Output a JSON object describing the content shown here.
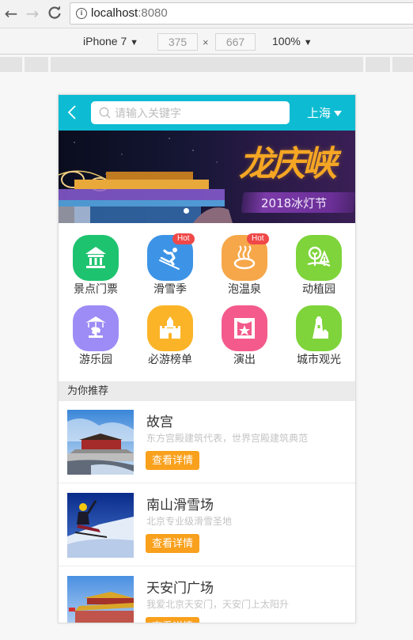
{
  "browser": {
    "back_icon": "←",
    "forward_icon": "→",
    "reload_icon": "C",
    "url_host": "localhost",
    "url_port": ":8080",
    "info_icon": "i"
  },
  "device_toolbar": {
    "device": "iPhone 7",
    "width": "375",
    "height": "667",
    "times": "×",
    "zoom": "100%",
    "caret": "▼"
  },
  "header": {
    "search_placeholder": "请输入关键字",
    "city": "上海",
    "colors": {
      "header_bg": "#0dbcd2"
    }
  },
  "banner": {
    "title": "龙庆峡",
    "subtitle": "2018冰灯节"
  },
  "categories": [
    {
      "label": "景点门票",
      "icon": "pavilion-icon",
      "color": "#1ec36f",
      "hot": false
    },
    {
      "label": "滑雪季",
      "icon": "skiing-icon",
      "color": "#3d94e6",
      "hot": true,
      "badge": "Hot"
    },
    {
      "label": "泡温泉",
      "icon": "hot-spring-icon",
      "color": "#f6a74a",
      "hot": true,
      "badge": "Hot"
    },
    {
      "label": "动植园",
      "icon": "trees-icon",
      "color": "#7ed43a",
      "hot": false
    },
    {
      "label": "游乐园",
      "icon": "carousel-icon",
      "color": "#9d8cf5",
      "hot": false
    },
    {
      "label": "必游榜单",
      "icon": "castle-icon",
      "color": "#fbb428",
      "hot": false
    },
    {
      "label": "演出",
      "icon": "stage-icon",
      "color": "#f45a8c",
      "hot": false
    },
    {
      "label": "城市观光",
      "icon": "lighthouse-icon",
      "color": "#7ed43a",
      "hot": false
    }
  ],
  "recommend": {
    "title": "为你推荐",
    "button_label": "查看详情",
    "button_color": "#f9a01c",
    "items": [
      {
        "name": "故宫",
        "desc": "东方宫殿建筑代表，世界宫殿建筑典范"
      },
      {
        "name": "南山滑雪场",
        "desc": "北京专业级滑雪圣地"
      },
      {
        "name": "天安门广场",
        "desc": "我爱北京天安门，天安门上太阳升"
      }
    ]
  }
}
